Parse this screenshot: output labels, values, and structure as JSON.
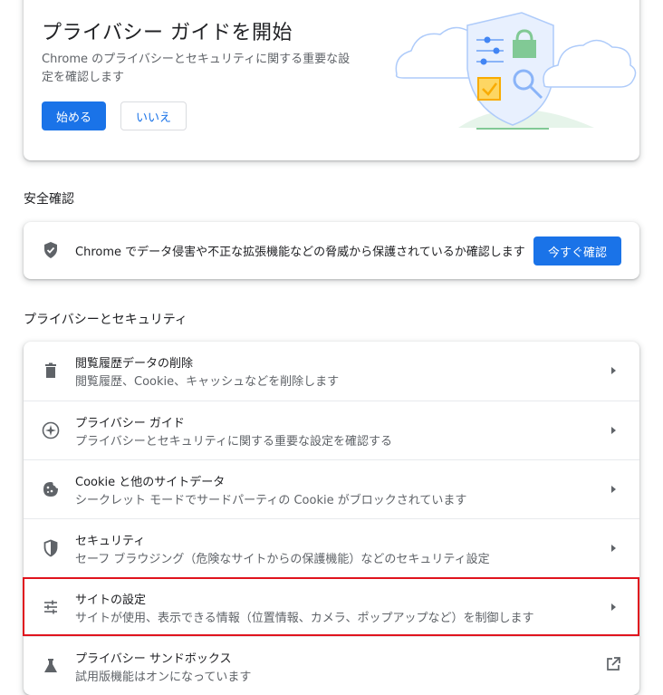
{
  "promo": {
    "title": "プライバシー ガイドを開始",
    "description": "Chrome のプライバシーとセキュリティに関する重要な設定を確認します",
    "start_label": "始める",
    "no_label": "いいえ"
  },
  "safety_check": {
    "heading": "安全確認",
    "text": "Chrome でデータ侵害や不正な拡張機能などの脅威から保護されているか確認します",
    "button_label": "今すぐ確認",
    "icon": "shield-check-icon"
  },
  "privacy_security": {
    "heading": "プライバシーとセキュリティ",
    "items": [
      {
        "title": "閲覧履歴データの削除",
        "subtitle": "閲覧履歴、Cookie、キャッシュなどを削除します",
        "icon": "trash-icon"
      },
      {
        "title": "プライバシー ガイド",
        "subtitle": "プライバシーとセキュリティに関する重要な設定を確認する",
        "icon": "compass-icon"
      },
      {
        "title": "Cookie と他のサイトデータ",
        "subtitle": "シークレット モードでサードパーティの Cookie がブロックされています",
        "icon": "cookie-icon"
      },
      {
        "title": "セキュリティ",
        "subtitle": "セーフ ブラウジング（危険なサイトからの保護機能）などのセキュリティ設定",
        "icon": "shield-icon"
      },
      {
        "title": "サイトの設定",
        "subtitle": "サイトが使用、表示できる情報（位置情報、カメラ、ポップアップなど）を制御します",
        "icon": "sliders-icon"
      },
      {
        "title": "プライバシー サンドボックス",
        "subtitle": "試用版機能はオンになっています",
        "icon": "flask-icon"
      }
    ]
  },
  "colors": {
    "accent": "#1a73e8",
    "highlight": "#e0141e"
  }
}
